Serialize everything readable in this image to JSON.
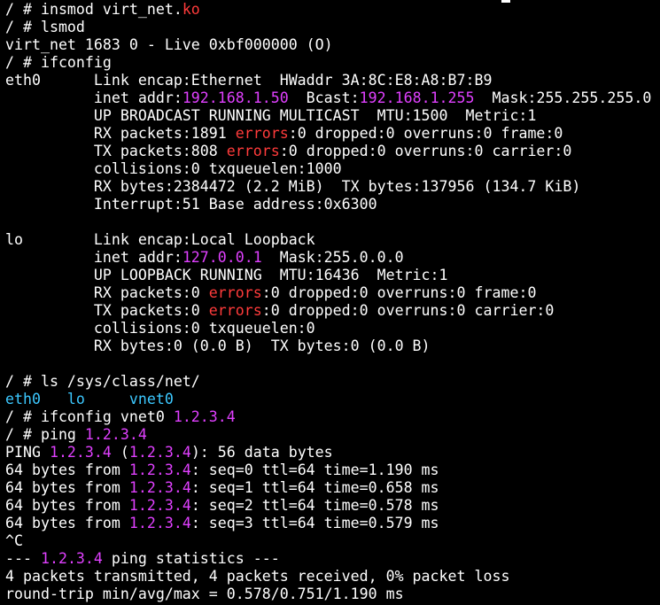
{
  "colors": {
    "background": "#000000",
    "text": "#ffffff",
    "keyword_red": "#ff3b3b",
    "ip_magenta": "#e040ff",
    "dir_cyan": "#3cc8ff"
  },
  "terminal": {
    "lines": [
      [
        {
          "t": "/ # insmod virt_net."
        },
        {
          "t": "ko",
          "c": "keyword_red"
        }
      ],
      [
        {
          "t": "/ # lsmod"
        }
      ],
      [
        {
          "t": "virt_net 1683 0 - Live 0xbf000000 (O)"
        }
      ],
      [
        {
          "t": "/ # ifconfig"
        }
      ],
      [
        {
          "t": "eth0      Link encap:Ethernet  HWaddr 3A:8C:E8:A8:B7:B9"
        }
      ],
      [
        {
          "t": "          inet addr:"
        },
        {
          "t": "192.168.1.50",
          "c": "ip_magenta"
        },
        {
          "t": "  Bcast:"
        },
        {
          "t": "192.168.1.255",
          "c": "ip_magenta"
        },
        {
          "t": "  Mask:255.255.255.0"
        }
      ],
      [
        {
          "t": "          UP BROADCAST RUNNING MULTICAST  MTU:1500  Metric:1"
        }
      ],
      [
        {
          "t": "          RX packets:1891 "
        },
        {
          "t": "errors",
          "c": "keyword_red"
        },
        {
          "t": ":0 dropped:0 overruns:0 frame:0"
        }
      ],
      [
        {
          "t": "          TX packets:808 "
        },
        {
          "t": "errors",
          "c": "keyword_red"
        },
        {
          "t": ":0 dropped:0 overruns:0 carrier:0"
        }
      ],
      [
        {
          "t": "          collisions:0 txqueuelen:1000"
        }
      ],
      [
        {
          "t": "          RX bytes:2384472 (2.2 MiB)  TX bytes:137956 (134.7 KiB)"
        }
      ],
      [
        {
          "t": "          Interrupt:51 Base address:0x6300"
        }
      ],
      [
        {
          "t": ""
        }
      ],
      [
        {
          "t": "lo        Link encap:Local Loopback"
        }
      ],
      [
        {
          "t": "          inet addr:"
        },
        {
          "t": "127.0.0.1",
          "c": "ip_magenta"
        },
        {
          "t": "  Mask:255.0.0.0"
        }
      ],
      [
        {
          "t": "          UP LOOPBACK RUNNING  MTU:16436  Metric:1"
        }
      ],
      [
        {
          "t": "          RX packets:0 "
        },
        {
          "t": "errors",
          "c": "keyword_red"
        },
        {
          "t": ":0 dropped:0 overruns:0 frame:0"
        }
      ],
      [
        {
          "t": "          TX packets:0 "
        },
        {
          "t": "errors",
          "c": "keyword_red"
        },
        {
          "t": ":0 dropped:0 overruns:0 carrier:0"
        }
      ],
      [
        {
          "t": "          collisions:0 txqueuelen:0"
        }
      ],
      [
        {
          "t": "          RX bytes:0 (0.0 B)  TX bytes:0 (0.0 B)"
        }
      ],
      [
        {
          "t": ""
        }
      ],
      [
        {
          "t": "/ # ls /sys/class/net/"
        }
      ],
      [
        {
          "t": "eth0   lo     vnet0",
          "c": "dir_cyan"
        }
      ],
      [
        {
          "t": "/ # ifconfig vnet0 "
        },
        {
          "t": "1.2.3.4",
          "c": "ip_magenta"
        }
      ],
      [
        {
          "t": "/ # ping "
        },
        {
          "t": "1.2.3.4",
          "c": "ip_magenta"
        }
      ],
      [
        {
          "t": "PING "
        },
        {
          "t": "1.2.3.4",
          "c": "ip_magenta"
        },
        {
          "t": " ("
        },
        {
          "t": "1.2.3.4",
          "c": "ip_magenta"
        },
        {
          "t": "): 56 data bytes"
        }
      ],
      [
        {
          "t": "64 bytes from "
        },
        {
          "t": "1.2.3.4",
          "c": "ip_magenta"
        },
        {
          "t": ": seq=0 ttl=64 time=1.190 ms"
        }
      ],
      [
        {
          "t": "64 bytes from "
        },
        {
          "t": "1.2.3.4",
          "c": "ip_magenta"
        },
        {
          "t": ": seq=1 ttl=64 time=0.658 ms"
        }
      ],
      [
        {
          "t": "64 bytes from "
        },
        {
          "t": "1.2.3.4",
          "c": "ip_magenta"
        },
        {
          "t": ": seq=2 ttl=64 time=0.578 ms"
        }
      ],
      [
        {
          "t": "64 bytes from "
        },
        {
          "t": "1.2.3.4",
          "c": "ip_magenta"
        },
        {
          "t": ": seq=3 ttl=64 time=0.579 ms"
        }
      ],
      [
        {
          "t": "^C"
        }
      ],
      [
        {
          "t": "--- "
        },
        {
          "t": "1.2.3.4",
          "c": "ip_magenta"
        },
        {
          "t": " ping statistics ---"
        }
      ],
      [
        {
          "t": "4 packets transmitted, 4 packets received, 0% packet loss"
        }
      ],
      [
        {
          "t": "round-trip min/avg/max = 0.578/0.751/1.190 ms"
        }
      ]
    ]
  }
}
